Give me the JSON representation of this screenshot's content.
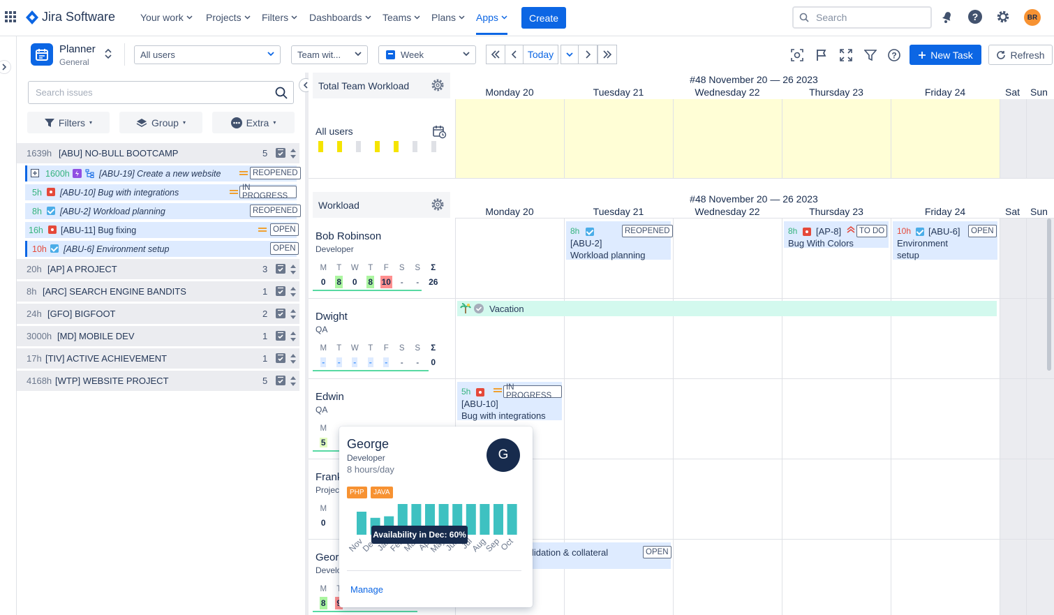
{
  "topnav": {
    "brand": "Jira Software",
    "items": [
      {
        "label": "Your work"
      },
      {
        "label": "Projects"
      },
      {
        "label": "Filters"
      },
      {
        "label": "Dashboards"
      },
      {
        "label": "Teams"
      },
      {
        "label": "Plans"
      },
      {
        "label": "Apps"
      }
    ],
    "create_label": "Create",
    "search_placeholder": "Search",
    "avatar_initials": "BR",
    "accent": "#0c66e4"
  },
  "toolbar": {
    "planner_title": "Planner",
    "planner_sub": "General",
    "users_select": "All users",
    "team_select": "Team wit...",
    "view_select": "Week",
    "today_label": "Today",
    "new_task_label": "New Task",
    "refresh_label": "Refresh"
  },
  "leftpanel": {
    "search_placeholder": "Search issues",
    "filters_label": "Filters",
    "group_label": "Group",
    "extra_label": "Extra",
    "projects": [
      {
        "hours": "1639h",
        "name": "[ABU] NO-BULL BOOTCAMP",
        "count": "5"
      },
      {
        "hours": "20h",
        "name": "[AP] A PROJECT",
        "count": "3"
      },
      {
        "hours": "8h",
        "name": "[ARC] SEARCH ENGINE BANDITS",
        "count": "1"
      },
      {
        "hours": "24h",
        "name": "[GFO] BIGFOOT",
        "count": "2"
      },
      {
        "hours": "3000h",
        "name": "[MD] MOBILE DEV",
        "count": "1"
      },
      {
        "hours": "17h",
        "name": "[TIV] ACTIVE ACHIEVEMENT",
        "count": "1"
      },
      {
        "hours": "4168h",
        "name": "[WTP] WEBSITE PROJECT",
        "count": "5"
      }
    ],
    "issues": [
      {
        "hours": "1600h",
        "title": "[ABU-19] Create a new website",
        "status": "REOPENED"
      },
      {
        "hours": "5h",
        "title": "[ABU-10] Bug with integrations",
        "status": "IN PROGRESS"
      },
      {
        "hours": "8h",
        "title": "[ABU-2] Workload planning",
        "status": "REOPENED"
      },
      {
        "hours": "16h",
        "title": "[ABU-11] Bug fixing",
        "status": "OPEN"
      },
      {
        "hours": "10h",
        "title": "[ABU-6] Environment setup",
        "status": "OPEN"
      }
    ]
  },
  "calendar": {
    "team_section": "Total Team Workload",
    "workload_section": "Workload",
    "week_label": "#48 November 20 — 26 2023",
    "days": [
      "Monday 20",
      "Tuesday 21",
      "Wednesday 22",
      "Thursday 23",
      "Friday 24",
      "Sat",
      "Sun"
    ],
    "all_users_label": "All users",
    "week_letters": [
      "M",
      "T",
      "W",
      "T",
      "F",
      "S",
      "S",
      "Σ"
    ],
    "users": [
      {
        "name": "Bob Robinson",
        "role": "Developer",
        "values": [
          "0",
          "8",
          "0",
          "8",
          "10",
          "-",
          "-",
          "26"
        ]
      },
      {
        "name": "Dwight",
        "role": "QA",
        "values": [
          "-",
          "-",
          "-",
          "-",
          "-",
          "-",
          "-",
          "0"
        ]
      },
      {
        "name": "Edwin",
        "role": "QA",
        "values": [
          "5"
        ]
      },
      {
        "name": "Frank",
        "role": "Project",
        "values": [
          "0"
        ]
      },
      {
        "name": "Georg",
        "role": "Develo",
        "values": [
          "8",
          "9"
        ]
      }
    ],
    "cards": [
      {
        "hours": "8h",
        "key": "[ABU-2]",
        "title": "Workload planning",
        "status": "REOPENED"
      },
      {
        "hours": "8h",
        "key": "[AP-8]",
        "title": "Bug With Colors",
        "status": "TO DO"
      },
      {
        "hours": "10h",
        "key": "[ABU-6]",
        "title": "Environment",
        "title2": "setup",
        "status": "OPEN"
      },
      {
        "hours": "5h",
        "key": "[ABU-10]",
        "title": "Bug with integrations",
        "status": "IN PROGRESS"
      },
      {
        "title": "lidation & collateral",
        "status": "OPEN"
      }
    ],
    "vacation_label": "Vacation"
  },
  "popup": {
    "name": "George",
    "role": "Developer",
    "capacity": "8 hours/day",
    "avatar_letter": "G",
    "skills": [
      "PHP",
      "JAVA"
    ],
    "months": [
      "Nov",
      "Dec",
      "Jan",
      "Feb",
      "Mar",
      "Apr",
      "May",
      "Jun",
      "Jul",
      "Aug",
      "Sep",
      "Oct"
    ],
    "availability": [
      0.75,
      0.55,
      0.6,
      1.0,
      1.0,
      1.0,
      1.0,
      1.0,
      1.0,
      1.0,
      1.0,
      1.0
    ],
    "tooltip": "Availability in Dec: 60%",
    "manage_label": "Manage",
    "bar_color": "#3ec1c1"
  }
}
